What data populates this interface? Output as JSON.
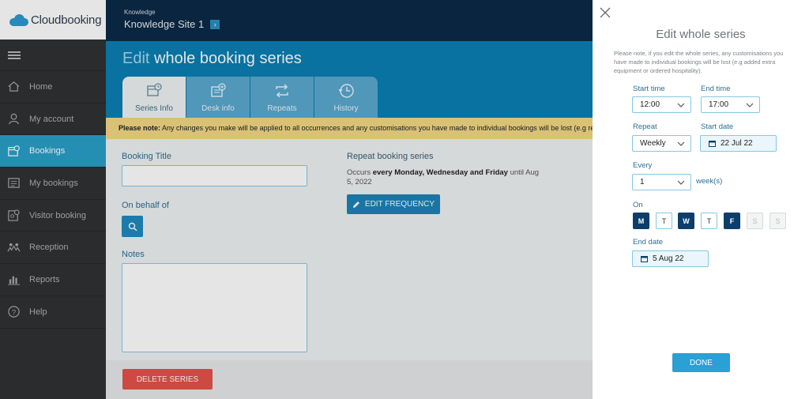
{
  "app": {
    "logo_text": "Cloudbooking"
  },
  "sidebar": {
    "items": [
      {
        "label": "Home",
        "icon": "home-icon"
      },
      {
        "label": "My account",
        "icon": "user-icon"
      },
      {
        "label": "Bookings",
        "icon": "bookings-icon",
        "active": true
      },
      {
        "label": "My bookings",
        "icon": "calendar-list-icon"
      },
      {
        "label": "Visitor booking",
        "icon": "visitor-icon"
      },
      {
        "label": "Reception",
        "icon": "reception-icon"
      },
      {
        "label": "Reports",
        "icon": "chart-icon"
      },
      {
        "label": "Help",
        "icon": "help-icon"
      }
    ]
  },
  "header": {
    "breadcrumb": "Knowledge",
    "site_name": "Knowledge Site 1",
    "site_chevron": "›"
  },
  "page": {
    "title_prefix": "Edit ",
    "title_main": "whole booking series",
    "tabs": [
      {
        "label": "Series Info",
        "icon": "series-info-icon",
        "active": true
      },
      {
        "label": "Desk info",
        "icon": "desk-info-icon"
      },
      {
        "label": "Repeats",
        "icon": "repeat-icon"
      },
      {
        "label": "History",
        "icon": "history-icon"
      }
    ],
    "note_bold": "Please note:",
    "note_text": " Any changes you make will be applied to all occurrences and any customisations you have made to individual bookings will be lost (e.g re"
  },
  "form": {
    "booking_title_label": "Booking Title",
    "booking_title_value": "",
    "on_behalf_label": "On behalf of",
    "notes_label": "Notes",
    "notes_value": "",
    "repeat_series_label": "Repeat booking series",
    "repeat_occurs_prefix": "Occurs ",
    "repeat_occurs_bold": "every Monday, Wednesday and Friday",
    "repeat_occurs_suffix": " until Aug 5, 2022",
    "edit_frequency_label": "EDIT FREQUENCY",
    "delete_series_label": "DELETE SERIES"
  },
  "panel": {
    "title": "Edit whole series",
    "note": "Please note, if you edit the whole series, any customisations you have made to individual bookings will be lost (e.g added extra equipment or ordered hospitality).",
    "start_time_label": "Start time",
    "start_time_value": "12:00",
    "end_time_label": "End time",
    "end_time_value": "17:00",
    "repeat_label": "Repeat",
    "repeat_value": "Weekly",
    "start_date_label": "Start date",
    "start_date_value": "22 Jul 22",
    "every_label": "Every",
    "every_value": "1",
    "every_unit": "week(s)",
    "on_label": "On",
    "days": [
      {
        "label": "M",
        "state": "on"
      },
      {
        "label": "T",
        "state": "default"
      },
      {
        "label": "W",
        "state": "on"
      },
      {
        "label": "T",
        "state": "default"
      },
      {
        "label": "F",
        "state": "on"
      },
      {
        "label": "S",
        "state": "off"
      },
      {
        "label": "S",
        "state": "off"
      }
    ],
    "end_date_label": "End date",
    "end_date_value": "5 Aug 22",
    "done_label": "DONE"
  },
  "colors": {
    "header_navy": "#0c2a47",
    "band_blue": "#0b7fb3",
    "sidebar_active": "#2aa0c8",
    "note_yellow": "#f2d784",
    "danger_red": "#e4534a",
    "day_selected": "#0c3e6b"
  }
}
